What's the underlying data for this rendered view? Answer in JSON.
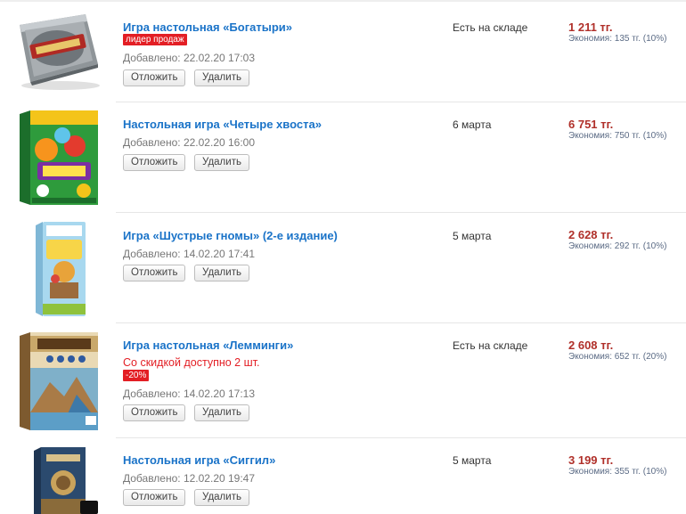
{
  "cart": {
    "defer_label": "Отложить",
    "delete_label": "Удалить",
    "items": [
      {
        "title": "Игра настольная «Богатыри»",
        "badge": "лидер продаж",
        "added": "Добавлено: 22.02.20 17:03",
        "availability": "Есть на складе",
        "price": "1 211 тг.",
        "savings": "Экономия: 135 тг. (10%)",
        "image_icon": "board-game-tin-box"
      },
      {
        "title": "Настольная игра «Четыре хвоста»",
        "added": "Добавлено: 22.02.20 16:00",
        "availability": "6 марта",
        "price": "6 751 тг.",
        "savings": "Экономия: 750 тг. (10%)",
        "image_icon": "board-game-box"
      },
      {
        "title": "Игра «Шустрые гномы» (2-е издание)",
        "added": "Добавлено: 14.02.20 17:41",
        "availability": "5 марта",
        "price": "2 628 тг.",
        "savings": "Экономия: 292 тг. (10%)",
        "image_icon": "card-game-box"
      },
      {
        "title": "Игра настольная «Лемминги»",
        "promo": "Со скидкой доступно 2 шт.",
        "badge": "-20%",
        "added": "Добавлено: 14.02.20 17:13",
        "availability": "Есть на складе",
        "price": "2 608 тг.",
        "savings": "Экономия: 652 тг. (20%)",
        "image_icon": "board-game-box"
      },
      {
        "title": "Настольная игра «Сиггил»",
        "added": "Добавлено: 12.02.20 19:47",
        "availability": "5 марта",
        "price": "3 199 тг.",
        "savings": "Экономия: 355 тг. (10%)",
        "image_icon": "card-game-box"
      }
    ]
  }
}
